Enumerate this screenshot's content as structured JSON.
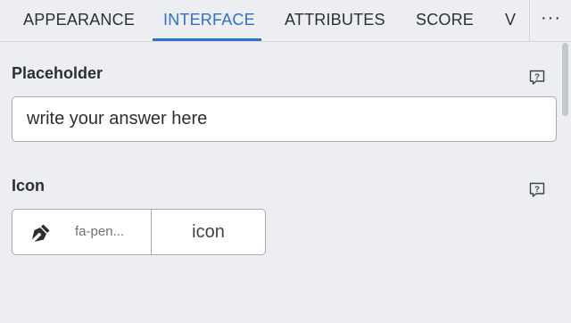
{
  "tabs": [
    {
      "label": "APPEARANCE",
      "active": false
    },
    {
      "label": "INTERFACE",
      "active": true
    },
    {
      "label": "ATTRIBUTES",
      "active": false
    },
    {
      "label": "SCORE",
      "active": false
    },
    {
      "label": "V",
      "active": false
    }
  ],
  "tabs_more_label": "···",
  "accent_color": "#2f6fcf",
  "placeholder_field": {
    "label": "Placeholder",
    "value": "write your answer here",
    "help_icon": "help-bubble-icon"
  },
  "icon_field": {
    "label": "Icon",
    "selected_icon": "fa-pen...",
    "icon_glyph": "pen-nib-icon",
    "type_label": "icon",
    "help_icon": "help-bubble-icon"
  }
}
